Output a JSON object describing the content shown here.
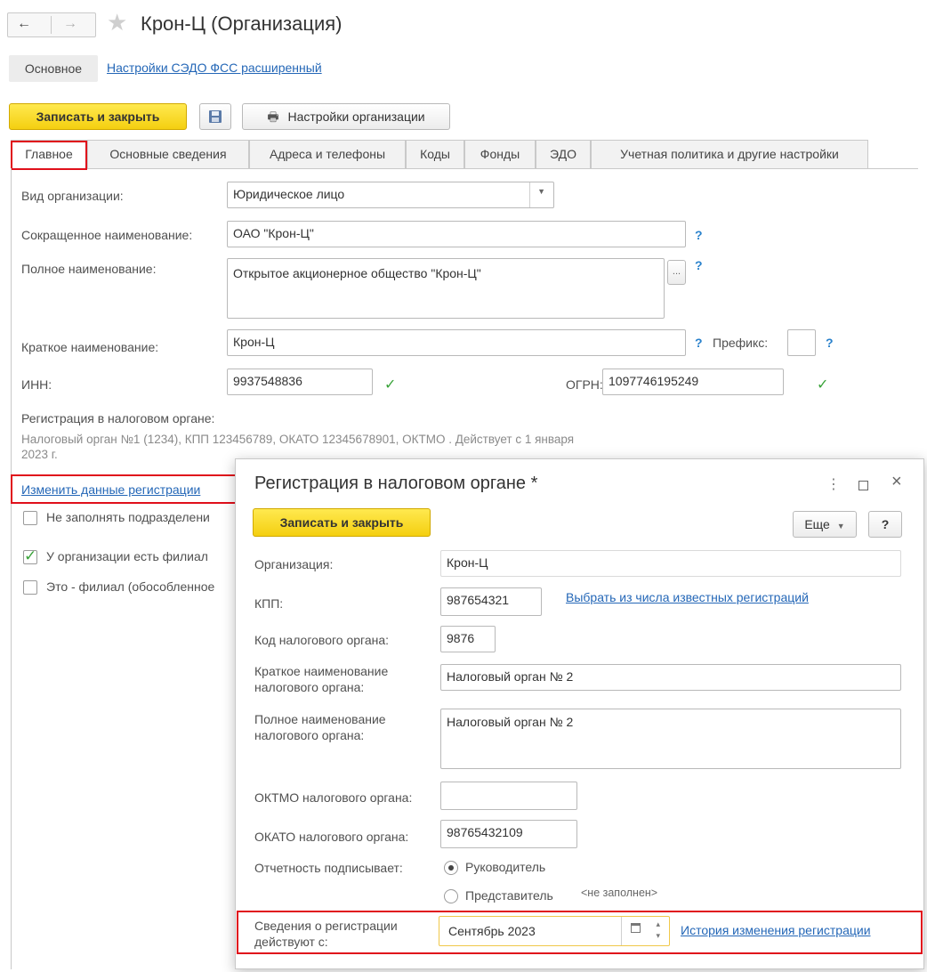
{
  "window": {
    "title": "Крон-Ц (Организация)",
    "nav_tabs": [
      "Основное",
      "Настройки СЭДО ФСС расширенный"
    ]
  },
  "toolbar": {
    "save_close": "Записать и закрыть",
    "settings": "Настройки организации"
  },
  "tabs": [
    "Главное",
    "Основные сведения",
    "Адреса и телефоны",
    "Коды",
    "Фонды",
    "ЭДО",
    "Учетная политика и другие настройки"
  ],
  "form": {
    "kind_label": "Вид организации:",
    "kind_value": "Юридическое лицо",
    "short_name_label": "Сокращенное наименование:",
    "short_name_value": "ОАО \"Крон-Ц\"",
    "full_name_label": "Полное наименование:",
    "full_name_value": "Открытое акционерное общество \"Крон-Ц\"",
    "brief_name_label": "Краткое наименование:",
    "brief_name_value": "Крон-Ц",
    "prefix_label": "Префикс:",
    "prefix_value": "",
    "inn_label": "ИНН:",
    "inn_value": "9937548836",
    "ogrn_label": "ОГРН:",
    "ogrn_value": "1097746195249",
    "reg_label": "Регистрация в налоговом органе:",
    "reg_info_line1": "Налоговый орган №1 (1234), КПП 123456789, ОКАТО 12345678901, ОКТМО . Действует с 1 января",
    "reg_info_line2": "2023 г.",
    "change_reg_link": "Изменить данные регистрации",
    "cb_no_fill": "Не заполнять подразделени",
    "cb_has_branches": "У организации есть филиал",
    "cb_is_branch": "Это - филиал (обособленное",
    "qmark": "?"
  },
  "dialog": {
    "title": "Регистрация в налоговом органе *",
    "save_close": "Записать и закрыть",
    "more": "Еще",
    "help": "?",
    "org_label": "Организация:",
    "org_value": "Крон-Ц",
    "kpp_label": "КПП:",
    "kpp_value": "987654321",
    "kpp_link": "Выбрать из числа известных регистраций",
    "code_label": "Код налогового органа:",
    "code_value": "9876",
    "brief_label_1": "Краткое наименование",
    "brief_label_2": "налогового органа:",
    "brief_value": "Налоговый орган № 2",
    "full_label_1": "Полное наименование",
    "full_label_2": "налогового органа:",
    "full_value": "Налоговый орган № 2",
    "oktmo_label": "ОКТМО налогового органа:",
    "oktmo_value": "",
    "okato_label": "ОКАТО налогового органа:",
    "okato_value": "98765432109",
    "signer_label": "Отчетность подписывает:",
    "signer_opt1": "Руководитель",
    "signer_opt2": "Представитель",
    "signer_placeholder": "<не заполнен>",
    "valid_label_1": "Сведения о регистрации",
    "valid_label_2": "действуют с:",
    "valid_value": "Сентябрь 2023",
    "history_link": "История изменения регистрации"
  },
  "colors": {
    "accent_yellow": "#f4cf10",
    "highlight_red": "#e0101b",
    "link_blue": "#2467b7",
    "help_blue": "#2a82cc",
    "ok_green": "#3aa33a"
  }
}
